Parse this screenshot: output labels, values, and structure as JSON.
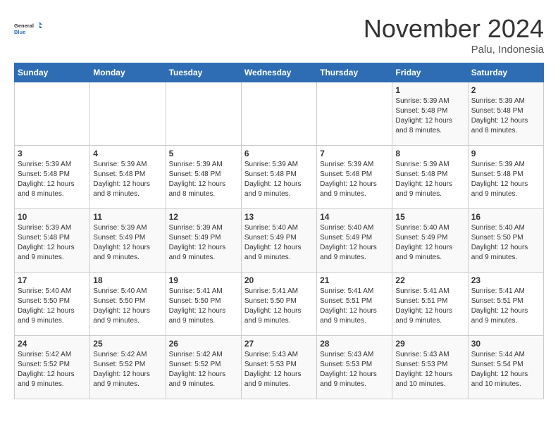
{
  "logo": {
    "general": "General",
    "blue": "Blue"
  },
  "title": "November 2024",
  "location": "Palu, Indonesia",
  "days_header": [
    "Sunday",
    "Monday",
    "Tuesday",
    "Wednesday",
    "Thursday",
    "Friday",
    "Saturday"
  ],
  "weeks": [
    [
      {
        "day": "",
        "text": ""
      },
      {
        "day": "",
        "text": ""
      },
      {
        "day": "",
        "text": ""
      },
      {
        "day": "",
        "text": ""
      },
      {
        "day": "",
        "text": ""
      },
      {
        "day": "1",
        "text": "Sunrise: 5:39 AM\nSunset: 5:48 PM\nDaylight: 12 hours and 8 minutes."
      },
      {
        "day": "2",
        "text": "Sunrise: 5:39 AM\nSunset: 5:48 PM\nDaylight: 12 hours and 8 minutes."
      }
    ],
    [
      {
        "day": "3",
        "text": "Sunrise: 5:39 AM\nSunset: 5:48 PM\nDaylight: 12 hours and 8 minutes."
      },
      {
        "day": "4",
        "text": "Sunrise: 5:39 AM\nSunset: 5:48 PM\nDaylight: 12 hours and 8 minutes."
      },
      {
        "day": "5",
        "text": "Sunrise: 5:39 AM\nSunset: 5:48 PM\nDaylight: 12 hours and 8 minutes."
      },
      {
        "day": "6",
        "text": "Sunrise: 5:39 AM\nSunset: 5:48 PM\nDaylight: 12 hours and 9 minutes."
      },
      {
        "day": "7",
        "text": "Sunrise: 5:39 AM\nSunset: 5:48 PM\nDaylight: 12 hours and 9 minutes."
      },
      {
        "day": "8",
        "text": "Sunrise: 5:39 AM\nSunset: 5:48 PM\nDaylight: 12 hours and 9 minutes."
      },
      {
        "day": "9",
        "text": "Sunrise: 5:39 AM\nSunset: 5:48 PM\nDaylight: 12 hours and 9 minutes."
      }
    ],
    [
      {
        "day": "10",
        "text": "Sunrise: 5:39 AM\nSunset: 5:48 PM\nDaylight: 12 hours and 9 minutes."
      },
      {
        "day": "11",
        "text": "Sunrise: 5:39 AM\nSunset: 5:49 PM\nDaylight: 12 hours and 9 minutes."
      },
      {
        "day": "12",
        "text": "Sunrise: 5:39 AM\nSunset: 5:49 PM\nDaylight: 12 hours and 9 minutes."
      },
      {
        "day": "13",
        "text": "Sunrise: 5:40 AM\nSunset: 5:49 PM\nDaylight: 12 hours and 9 minutes."
      },
      {
        "day": "14",
        "text": "Sunrise: 5:40 AM\nSunset: 5:49 PM\nDaylight: 12 hours and 9 minutes."
      },
      {
        "day": "15",
        "text": "Sunrise: 5:40 AM\nSunset: 5:49 PM\nDaylight: 12 hours and 9 minutes."
      },
      {
        "day": "16",
        "text": "Sunrise: 5:40 AM\nSunset: 5:50 PM\nDaylight: 12 hours and 9 minutes."
      }
    ],
    [
      {
        "day": "17",
        "text": "Sunrise: 5:40 AM\nSunset: 5:50 PM\nDaylight: 12 hours and 9 minutes."
      },
      {
        "day": "18",
        "text": "Sunrise: 5:40 AM\nSunset: 5:50 PM\nDaylight: 12 hours and 9 minutes."
      },
      {
        "day": "19",
        "text": "Sunrise: 5:41 AM\nSunset: 5:50 PM\nDaylight: 12 hours and 9 minutes."
      },
      {
        "day": "20",
        "text": "Sunrise: 5:41 AM\nSunset: 5:50 PM\nDaylight: 12 hours and 9 minutes."
      },
      {
        "day": "21",
        "text": "Sunrise: 5:41 AM\nSunset: 5:51 PM\nDaylight: 12 hours and 9 minutes."
      },
      {
        "day": "22",
        "text": "Sunrise: 5:41 AM\nSunset: 5:51 PM\nDaylight: 12 hours and 9 minutes."
      },
      {
        "day": "23",
        "text": "Sunrise: 5:41 AM\nSunset: 5:51 PM\nDaylight: 12 hours and 9 minutes."
      }
    ],
    [
      {
        "day": "24",
        "text": "Sunrise: 5:42 AM\nSunset: 5:52 PM\nDaylight: 12 hours and 9 minutes."
      },
      {
        "day": "25",
        "text": "Sunrise: 5:42 AM\nSunset: 5:52 PM\nDaylight: 12 hours and 9 minutes."
      },
      {
        "day": "26",
        "text": "Sunrise: 5:42 AM\nSunset: 5:52 PM\nDaylight: 12 hours and 9 minutes."
      },
      {
        "day": "27",
        "text": "Sunrise: 5:43 AM\nSunset: 5:53 PM\nDaylight: 12 hours and 9 minutes."
      },
      {
        "day": "28",
        "text": "Sunrise: 5:43 AM\nSunset: 5:53 PM\nDaylight: 12 hours and 9 minutes."
      },
      {
        "day": "29",
        "text": "Sunrise: 5:43 AM\nSunset: 5:53 PM\nDaylight: 12 hours and 10 minutes."
      },
      {
        "day": "30",
        "text": "Sunrise: 5:44 AM\nSunset: 5:54 PM\nDaylight: 12 hours and 10 minutes."
      }
    ]
  ]
}
